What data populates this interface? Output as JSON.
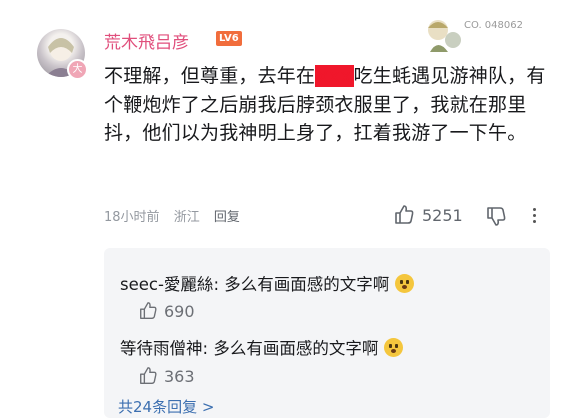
{
  "comment": {
    "username": "荒木飛吕彦",
    "level": "LV6",
    "decoration_text": "CO. 048062",
    "text_before": "不理解，但尊重，去年在",
    "redacted": "xxx",
    "text_after": "吃生蚝遇见游神队，有个鞭炮炸了之后崩我后脖颈衣服里了，我就在那里抖，他们以为我神明上身了，扛着我游了一下午。",
    "time": "18小时前",
    "location": "浙江",
    "reply_label": "回复",
    "likes": "5251"
  },
  "replies": [
    {
      "author": "seec-愛麗絲",
      "text": "多么有画面感的文字啊",
      "likes": "690"
    },
    {
      "author": "等待雨僧神",
      "text": "多么有画面感的文字啊",
      "likes": "363"
    }
  ],
  "more_replies": "共24条回复 >",
  "colors": {
    "username": "#e04f7c",
    "level_badge": "#f16d3c",
    "redaction": "#f0172b"
  }
}
